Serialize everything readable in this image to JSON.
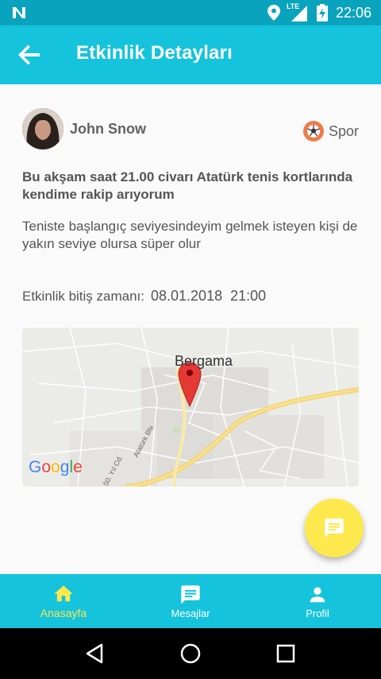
{
  "status_bar": {
    "network_label": "LTE",
    "time": "22:06"
  },
  "app_bar": {
    "title": "Etkinlik Detayları"
  },
  "event": {
    "user_name": "John Snow",
    "category": "Spor",
    "headline": "Bu akşam saat 21.00 civarı Atatürk tenis kortlarında kendime rakip arıyorum",
    "description": "Teniste başlangıç seviyesindeyim gelmek isteyen kişi de yakın seviye olursa süper olur",
    "end_time_label": "Etkinlik bitiş zamanı:",
    "end_time_value": "08.01.2018  21:00"
  },
  "map": {
    "city_label": "Bergama",
    "road_label_1": "Atatürk Blv.",
    "road_label_2": "50. Yıl Cd.",
    "logo": "Google"
  },
  "bottom_nav": {
    "items": [
      {
        "label": "Anasayfa",
        "icon": "home-icon",
        "active": true
      },
      {
        "label": "Mesajlar",
        "icon": "message-icon",
        "active": false
      },
      {
        "label": "Profil",
        "icon": "person-icon",
        "active": false
      }
    ]
  },
  "colors": {
    "primary": "#16c3dc",
    "status_bar": "#0aa3bd",
    "accent": "#fde94d",
    "text": "#555555"
  }
}
